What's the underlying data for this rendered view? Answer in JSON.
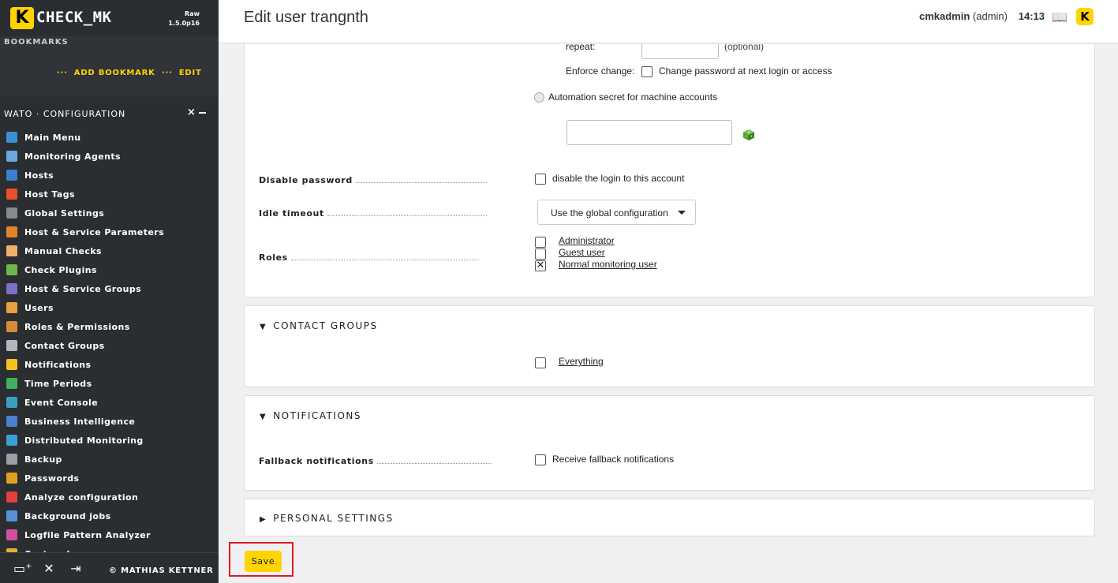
{
  "branding": {
    "logo_letter": "K",
    "logo_text": "CHECK_MK",
    "edition": "Raw",
    "version": "1.5.0p16",
    "accent_color": "#ffd400"
  },
  "sidebar": {
    "bookmarks_title": "BOOKMARKS",
    "add_bookmark": "ADD BOOKMARK",
    "edit": "EDIT",
    "link_dots": "···",
    "wato_title": "WATO · CONFIGURATION",
    "wato_close": "×",
    "items": [
      {
        "label": "Main Menu",
        "icon": "main-menu-icon",
        "color": "#3a8fd6"
      },
      {
        "label": "Monitoring Agents",
        "icon": "agent-icon",
        "color": "#6aa6e0"
      },
      {
        "label": "Hosts",
        "icon": "hosts-icon",
        "color": "#3b7fd0"
      },
      {
        "label": "Host Tags",
        "icon": "tag-icon",
        "color": "#e8502a"
      },
      {
        "label": "Global Settings",
        "icon": "gear-icon",
        "color": "#8a8a8a"
      },
      {
        "label": "Host & Service Parameters",
        "icon": "parameters-icon",
        "color": "#e0862a"
      },
      {
        "label": "Manual Checks",
        "icon": "hand-icon",
        "color": "#f0b070"
      },
      {
        "label": "Check Plugins",
        "icon": "plugin-icon",
        "color": "#6cb84a"
      },
      {
        "label": "Host & Service Groups",
        "icon": "groups-icon",
        "color": "#7b6fc8"
      },
      {
        "label": "Users",
        "icon": "users-icon",
        "color": "#e8a040"
      },
      {
        "label": "Roles & Permissions",
        "icon": "roles-icon",
        "color": "#d88a3a"
      },
      {
        "label": "Contact Groups",
        "icon": "contact-groups-icon",
        "color": "#b0b8c0"
      },
      {
        "label": "Notifications",
        "icon": "bell-icon",
        "color": "#f5c020"
      },
      {
        "label": "Time Periods",
        "icon": "clock-icon",
        "color": "#40b060"
      },
      {
        "label": "Event Console",
        "icon": "event-console-icon",
        "color": "#3aa0c0"
      },
      {
        "label": "Business Intelligence",
        "icon": "bi-icon",
        "color": "#4a80d0"
      },
      {
        "label": "Distributed Monitoring",
        "icon": "globe-icon",
        "color": "#3aa0d8"
      },
      {
        "label": "Backup",
        "icon": "backup-icon",
        "color": "#9aa0a8"
      },
      {
        "label": "Passwords",
        "icon": "key-icon",
        "color": "#e0a020"
      },
      {
        "label": "Analyze configuration",
        "icon": "analyze-icon",
        "color": "#e04040"
      },
      {
        "label": "Background jobs",
        "icon": "jobs-icon",
        "color": "#5a90d8"
      },
      {
        "label": "Logfile Pattern Analyzer",
        "icon": "flask-icon",
        "color": "#d050a0"
      },
      {
        "label": "Custom Icons",
        "icon": "custom-icons-icon",
        "color": "#e0b030"
      }
    ],
    "footer": {
      "copyright": "© MATHIAS KETTNER",
      "add_snapin_glyph": "▭⁺",
      "tools_glyph": "✕",
      "logout_glyph": "⇥"
    }
  },
  "header": {
    "title": "Edit user trangnth",
    "user": "cmkadmin",
    "role": "(admin)",
    "time": "14:13",
    "book_glyph": "📖",
    "logo_letter": "K"
  },
  "form": {
    "repeat_label": "repeat:",
    "optional": "(optional)",
    "enforce_label": "Enforce change:",
    "enforce_text": "Change password at next login or access",
    "enforce_checked": false,
    "automation_label": "Automation secret for machine accounts",
    "automation_value": "",
    "disable_password_label": "Disable password",
    "disable_login_text": "disable the login to this account",
    "disable_login_checked": false,
    "idle_timeout_label": "Idle timeout",
    "idle_timeout_value": "Use the global configuration",
    "roles_label": "Roles",
    "roles": [
      {
        "label": "Administrator",
        "checked": false,
        "mark": ""
      },
      {
        "label": "Guest user",
        "checked": false,
        "mark": ""
      },
      {
        "label": "Normal monitoring user",
        "checked": true,
        "mark": "✕"
      }
    ]
  },
  "contact_groups": {
    "title": "CONTACT GROUPS",
    "arrow": "▼",
    "groups": [
      {
        "label": "Everything",
        "checked": false
      }
    ]
  },
  "notifications": {
    "title": "NOTIFICATIONS",
    "arrow": "▼",
    "fallback_label": "Fallback notifications",
    "fallback_text": "Receive fallback notifications",
    "fallback_checked": false
  },
  "personal_settings": {
    "title": "PERSONAL SETTINGS",
    "arrow": "▶"
  },
  "actions": {
    "save": "Save"
  }
}
